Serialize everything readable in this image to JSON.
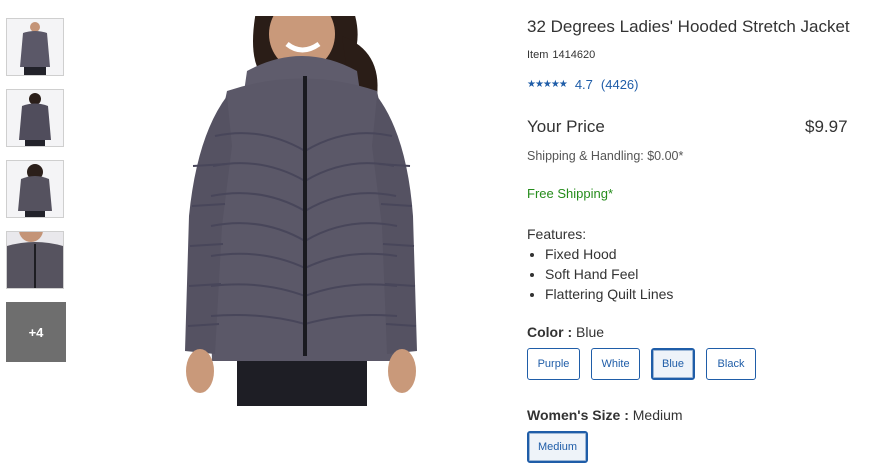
{
  "gallery": {
    "more_label": "+4"
  },
  "product": {
    "title": "32 Degrees Ladies' Hooded Stretch Jacket",
    "item_label": "Item",
    "item_number": "1414620",
    "rating": {
      "stars": 4.7,
      "average": "4.7",
      "count": "(4426)"
    },
    "price_label": "Your Price",
    "price": "$9.97",
    "shipping": "Shipping & Handling: $0.00*",
    "free_shipping": "Free Shipping*",
    "features_heading": "Features:",
    "features": [
      "Fixed Hood",
      "Soft Hand Feel",
      "Flattering Quilt Lines"
    ],
    "color": {
      "label": "Color :",
      "selected": "Blue",
      "options": [
        "Purple",
        "White",
        "Blue",
        "Black"
      ]
    },
    "size": {
      "label": "Women's Size :",
      "selected": "Medium",
      "options": [
        "Medium"
      ]
    }
  },
  "colors": {
    "link_blue": "#1f5da8",
    "free_shipping_green": "#258c1b",
    "jacket": "#5b5868",
    "more_tile": "#6e6e6e"
  },
  "icons": {
    "star": "star-icon"
  }
}
